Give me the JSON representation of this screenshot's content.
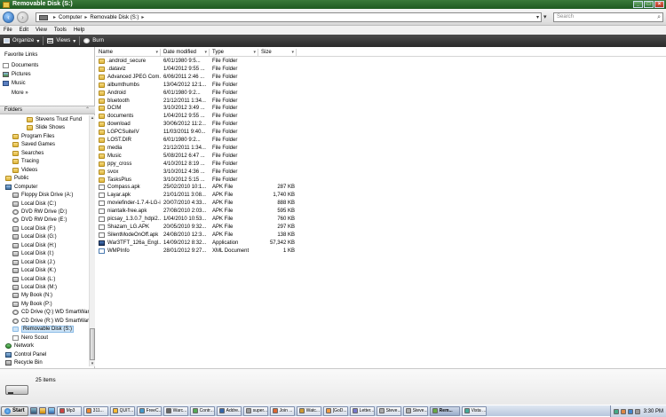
{
  "window": {
    "title": "Removable Disk (S:)"
  },
  "address": {
    "crumbs": [
      "Computer",
      "Removable Disk (S:)"
    ],
    "search_placeholder": "Search"
  },
  "menu": [
    "File",
    "Edit",
    "View",
    "Tools",
    "Help"
  ],
  "toolbar": {
    "organize": "Organize",
    "views": "Views",
    "burn": "Burn"
  },
  "favorites": {
    "heading": "Favorite Links",
    "items": [
      "Documents",
      "Pictures",
      "Music"
    ],
    "more": "More"
  },
  "folders_heading": "Folders",
  "tree": [
    {
      "label": "Stevens Trust Fund",
      "level": 3,
      "icon": "folder-icon"
    },
    {
      "label": "Slide Shows",
      "level": 3,
      "icon": "folder-icon"
    },
    {
      "label": "Program Files",
      "level": 2,
      "icon": "folder-icon"
    },
    {
      "label": "Saved Games",
      "level": 2,
      "icon": "folder-icon"
    },
    {
      "label": "Searches",
      "level": 2,
      "icon": "folder-icon"
    },
    {
      "label": "Tracing",
      "level": 2,
      "icon": "folder-icon"
    },
    {
      "label": "Videos",
      "level": 2,
      "icon": "folder-icon"
    },
    {
      "label": "Public",
      "level": 1,
      "icon": "folder-icon"
    },
    {
      "label": "Computer",
      "level": 1,
      "icon": "computer-icon"
    },
    {
      "label": "Floppy Disk Drive (A:)",
      "level": 2,
      "icon": "drive-icon"
    },
    {
      "label": "Local Disk (C:)",
      "level": 2,
      "icon": "drive-icon"
    },
    {
      "label": "DVD RW Drive (D:)",
      "level": 2,
      "icon": "cd-drive-icon"
    },
    {
      "label": "DVD RW Drive (E:)",
      "level": 2,
      "icon": "cd-drive-icon"
    },
    {
      "label": "Local Disk (F:)",
      "level": 2,
      "icon": "drive-icon"
    },
    {
      "label": "Local Disk (G:)",
      "level": 2,
      "icon": "drive-icon"
    },
    {
      "label": "Local Disk (H:)",
      "level": 2,
      "icon": "drive-icon"
    },
    {
      "label": "Local Disk (I:)",
      "level": 2,
      "icon": "drive-icon"
    },
    {
      "label": "Local Disk (J:)",
      "level": 2,
      "icon": "drive-icon"
    },
    {
      "label": "Local Disk (K:)",
      "level": 2,
      "icon": "drive-icon"
    },
    {
      "label": "Local Disk (L:)",
      "level": 2,
      "icon": "drive-icon"
    },
    {
      "label": "Local Disk (M:)",
      "level": 2,
      "icon": "drive-icon"
    },
    {
      "label": "My Book (N:)",
      "level": 2,
      "icon": "drive-icon"
    },
    {
      "label": "My Book (P:)",
      "level": 2,
      "icon": "drive-icon"
    },
    {
      "label": "CD Drive (Q:) WD SmartWare",
      "level": 2,
      "icon": "cd-drive-icon"
    },
    {
      "label": "CD Drive (R:) WD SmartWare",
      "level": 2,
      "icon": "cd-drive-icon"
    },
    {
      "label": "Removable Disk (S:)",
      "level": 2,
      "icon": "drive-icon",
      "selected": true
    },
    {
      "label": "Nero Scout",
      "level": 2,
      "icon": "document-icon"
    },
    {
      "label": "Network",
      "level": 1,
      "icon": "network-icon"
    },
    {
      "label": "Control Panel",
      "level": 1,
      "icon": "control-panel-icon"
    },
    {
      "label": "Recycle Bin",
      "level": 1,
      "icon": "recycle-bin-icon"
    }
  ],
  "columns": [
    "Name",
    "Date modified",
    "Type",
    "Size"
  ],
  "files": [
    {
      "name": ".android_secure",
      "date": "6/01/1980 9:5...",
      "type": "File Folder",
      "size": "",
      "icon": "folder-icon"
    },
    {
      "name": ".dataviz",
      "date": "1/04/2012 9:55 ...",
      "type": "File Folder",
      "size": "",
      "icon": "folder-icon"
    },
    {
      "name": "Advanced JPEG Com...",
      "date": "6/06/2011 2:46 ...",
      "type": "File Folder",
      "size": "",
      "icon": "folder-icon"
    },
    {
      "name": "albumthumbs",
      "date": "13/04/2012 12:1...",
      "type": "File Folder",
      "size": "",
      "icon": "folder-icon"
    },
    {
      "name": "Android",
      "date": "6/01/1980 9:2...",
      "type": "File Folder",
      "size": "",
      "icon": "folder-icon"
    },
    {
      "name": "bluetooth",
      "date": "21/12/2011 1:34...",
      "type": "File Folder",
      "size": "",
      "icon": "folder-icon"
    },
    {
      "name": "DCIM",
      "date": "3/10/2012 3:49 ...",
      "type": "File Folder",
      "size": "",
      "icon": "folder-icon"
    },
    {
      "name": "documents",
      "date": "1/04/2012 9:55 ...",
      "type": "File Folder",
      "size": "",
      "icon": "folder-icon"
    },
    {
      "name": "download",
      "date": "30/06/2012 11:2...",
      "type": "File Folder",
      "size": "",
      "icon": "folder-icon"
    },
    {
      "name": "LGPCSuiteIV",
      "date": "11/03/2011 9:40...",
      "type": "File Folder",
      "size": "",
      "icon": "folder-icon"
    },
    {
      "name": "LOST.DIR",
      "date": "6/01/1980 9:2...",
      "type": "File Folder",
      "size": "",
      "icon": "folder-icon"
    },
    {
      "name": "media",
      "date": "21/12/2011 1:34...",
      "type": "File Folder",
      "size": "",
      "icon": "folder-icon"
    },
    {
      "name": "Music",
      "date": "5/08/2012 6:47 ...",
      "type": "File Folder",
      "size": "",
      "icon": "folder-icon"
    },
    {
      "name": "ppy_cross",
      "date": "4/10/2012 8:19 ...",
      "type": "File Folder",
      "size": "",
      "icon": "folder-icon"
    },
    {
      "name": "svox",
      "date": "3/10/2012 4:36 ...",
      "type": "File Folder",
      "size": "",
      "icon": "folder-icon"
    },
    {
      "name": "TasksPlus",
      "date": "3/10/2012 5:15 ...",
      "type": "File Folder",
      "size": "",
      "icon": "folder-icon"
    },
    {
      "name": "Compass.apk",
      "date": "25/02/2010 10:1...",
      "type": "APK File",
      "size": "287 KB",
      "icon": "apk-file-icon"
    },
    {
      "name": "Layar.apk",
      "date": "21/01/2011 3:08...",
      "type": "APK File",
      "size": "1,740 KB",
      "icon": "apk-file-icon"
    },
    {
      "name": "moviefinder-1.7.4-LG-i...",
      "date": "20/07/2010 4:33...",
      "type": "APK File",
      "size": "888 KB",
      "icon": "apk-file-icon"
    },
    {
      "name": "niantalk-free.apk",
      "date": "27/08/2010 2:03...",
      "type": "APK File",
      "size": "595 KB",
      "icon": "apk-file-icon"
    },
    {
      "name": "picsay_1.3.0.7_hdpi2...",
      "date": "1/04/2010 10:53...",
      "type": "APK File",
      "size": "760 KB",
      "icon": "apk-file-icon"
    },
    {
      "name": "Shazam_LG.APK",
      "date": "20/05/2010 9:32...",
      "type": "APK File",
      "size": "297 KB",
      "icon": "apk-file-icon"
    },
    {
      "name": "SilentModeOnOff.apk",
      "date": "24/08/2010 12:3...",
      "type": "APK File",
      "size": "138 KB",
      "icon": "apk-file-icon"
    },
    {
      "name": "War3TFT_126a_Engl...",
      "date": "14/09/2012 8:32...",
      "type": "Application",
      "size": "57,342 KB",
      "icon": "application-icon"
    },
    {
      "name": "WMPInfo",
      "date": "28/01/2012 9:27...",
      "type": "XML Document",
      "size": "1 KB",
      "icon": "xml-document-icon"
    }
  ],
  "status": {
    "count": "25 items"
  },
  "taskbar": {
    "start": "Start",
    "items": [
      {
        "label": "Mp3",
        "active": false
      },
      {
        "label": "311...",
        "active": false
      },
      {
        "label": "QUIT...",
        "active": false
      },
      {
        "label": "FreeC...",
        "active": false
      },
      {
        "label": "Warc...",
        "active": false
      },
      {
        "label": "Contr...",
        "active": false
      },
      {
        "label": "Addre...",
        "active": false
      },
      {
        "label": "super...",
        "active": false
      },
      {
        "label": "Join ...",
        "active": false
      },
      {
        "label": "Watc...",
        "active": false
      },
      {
        "label": "[GoD...",
        "active": false
      },
      {
        "label": "Letter...",
        "active": false
      },
      {
        "label": "Steve...",
        "active": false
      },
      {
        "label": "Steve...",
        "active": false
      },
      {
        "label": "Rem...",
        "active": true
      },
      {
        "label": "Vista ...",
        "active": false
      }
    ],
    "clock": "3:30 PM"
  },
  "colors": {
    "titlebar": "#2a6a2e",
    "toolbar": "#3a3a3a",
    "selection": "#cde4f7",
    "folder": "#e8c45a"
  }
}
